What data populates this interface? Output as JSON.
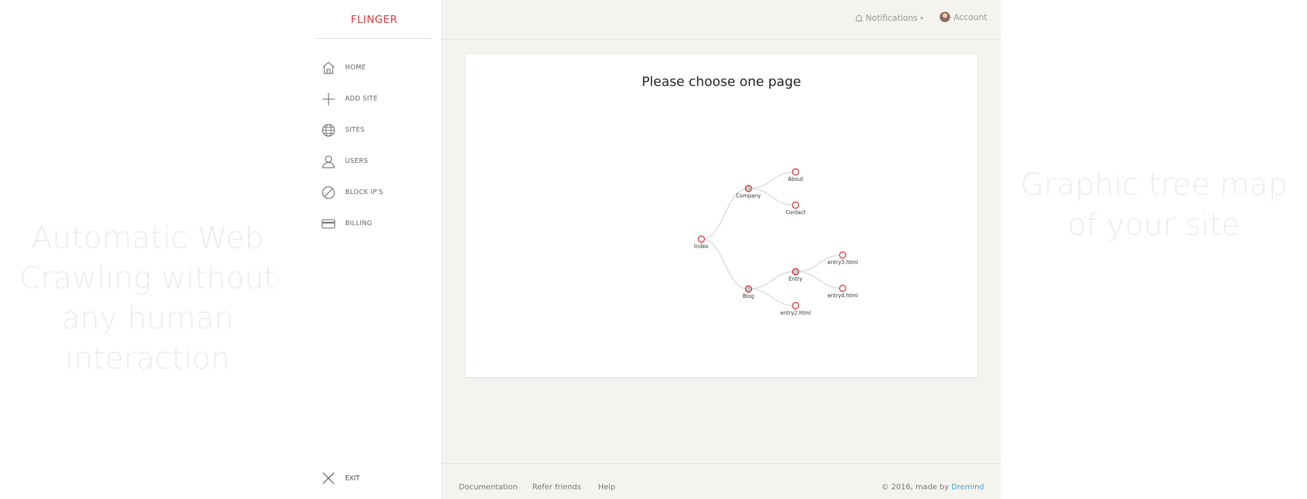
{
  "promo": {
    "left": "Automatic Web Crawling without any human interaction",
    "right": "Graphic tree map of your site"
  },
  "brand": "FLINGER",
  "sidebar": {
    "items": [
      {
        "label": "HOME",
        "icon": "home-icon"
      },
      {
        "label": "ADD SITE",
        "icon": "plus-icon"
      },
      {
        "label": "SITES",
        "icon": "globe-icon"
      },
      {
        "label": "USERS",
        "icon": "user-icon"
      },
      {
        "label": "BLOCK IP'S",
        "icon": "block-icon"
      },
      {
        "label": "BILLING",
        "icon": "credit-card-icon"
      }
    ],
    "exit": "EXIT"
  },
  "header": {
    "notifications": "Notifications",
    "account": "Account"
  },
  "card": {
    "title": "Please choose one page"
  },
  "tree": {
    "nodes": [
      {
        "label": "Index"
      },
      {
        "label": "Company"
      },
      {
        "label": "About"
      },
      {
        "label": "Contact"
      },
      {
        "label": "Blog"
      },
      {
        "label": "Entry"
      },
      {
        "label": "entry3.html"
      },
      {
        "label": "entry4.html"
      },
      {
        "label": "entry2.html"
      }
    ]
  },
  "footer": {
    "links": [
      "Documentation",
      "Refer friends",
      "Help"
    ],
    "copyright": "© 2016, made by",
    "maker": "Dremind"
  },
  "colors": {
    "accent": "#d23b3b",
    "link": "#4aa3c4",
    "main_bg": "#f4f3ef"
  }
}
